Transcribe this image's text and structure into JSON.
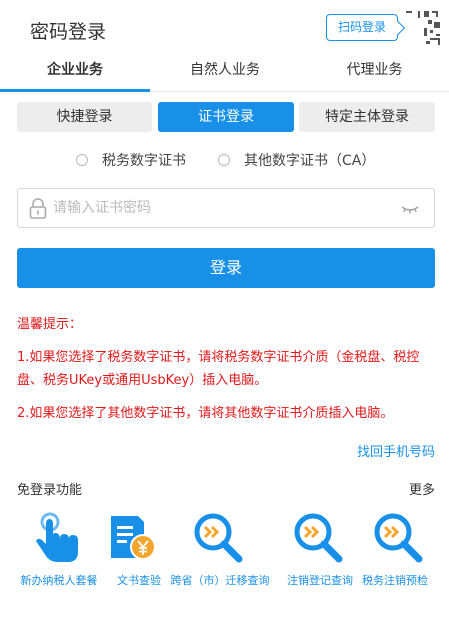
{
  "header": {
    "title": "密码登录",
    "qr_label": "扫码登录"
  },
  "tabs": [
    {
      "label": "企业业务",
      "active": true
    },
    {
      "label": "自然人业务",
      "active": false
    },
    {
      "label": "代理业务",
      "active": false
    }
  ],
  "login_tabs": [
    {
      "label": "快捷登录",
      "active": false
    },
    {
      "label": "证书登录",
      "active": true
    },
    {
      "label": "特定主体登录",
      "active": false
    }
  ],
  "cert_options": [
    {
      "label": "税务数字证书",
      "checked": false
    },
    {
      "label": "其他数字证书（CA）",
      "checked": false
    }
  ],
  "password": {
    "placeholder": "请输入证书密码",
    "value": ""
  },
  "login_button": "登录",
  "tips": {
    "title": "温馨提示：",
    "line1": "1.如果您选择了税务数字证书，请将税务数字证书介质（金税盘、税控盘、税务UKey或通用UsbKey）插入电脑。",
    "line2": "2.如果您选择了其他数字证书，请将其他数字证书介质插入电脑。"
  },
  "recover_phone": "找回手机号码",
  "quick_access": {
    "title": "免登录功能",
    "more": "更多",
    "items": [
      {
        "label": "新办纳税人套餐",
        "icon": "hand-tap-icon"
      },
      {
        "label": "文书查验",
        "icon": "document-yen-icon"
      },
      {
        "label": "跨省（市）迁移查询",
        "icon": "search-arrows-icon"
      },
      {
        "label": "注销登记查询",
        "icon": "search-arrows-icon"
      },
      {
        "label": "税务注销预检",
        "icon": "search-arrows-icon"
      }
    ]
  },
  "colors": {
    "primary": "#1890e8",
    "warning": "#e0191a",
    "tab_bg": "#ededed"
  }
}
